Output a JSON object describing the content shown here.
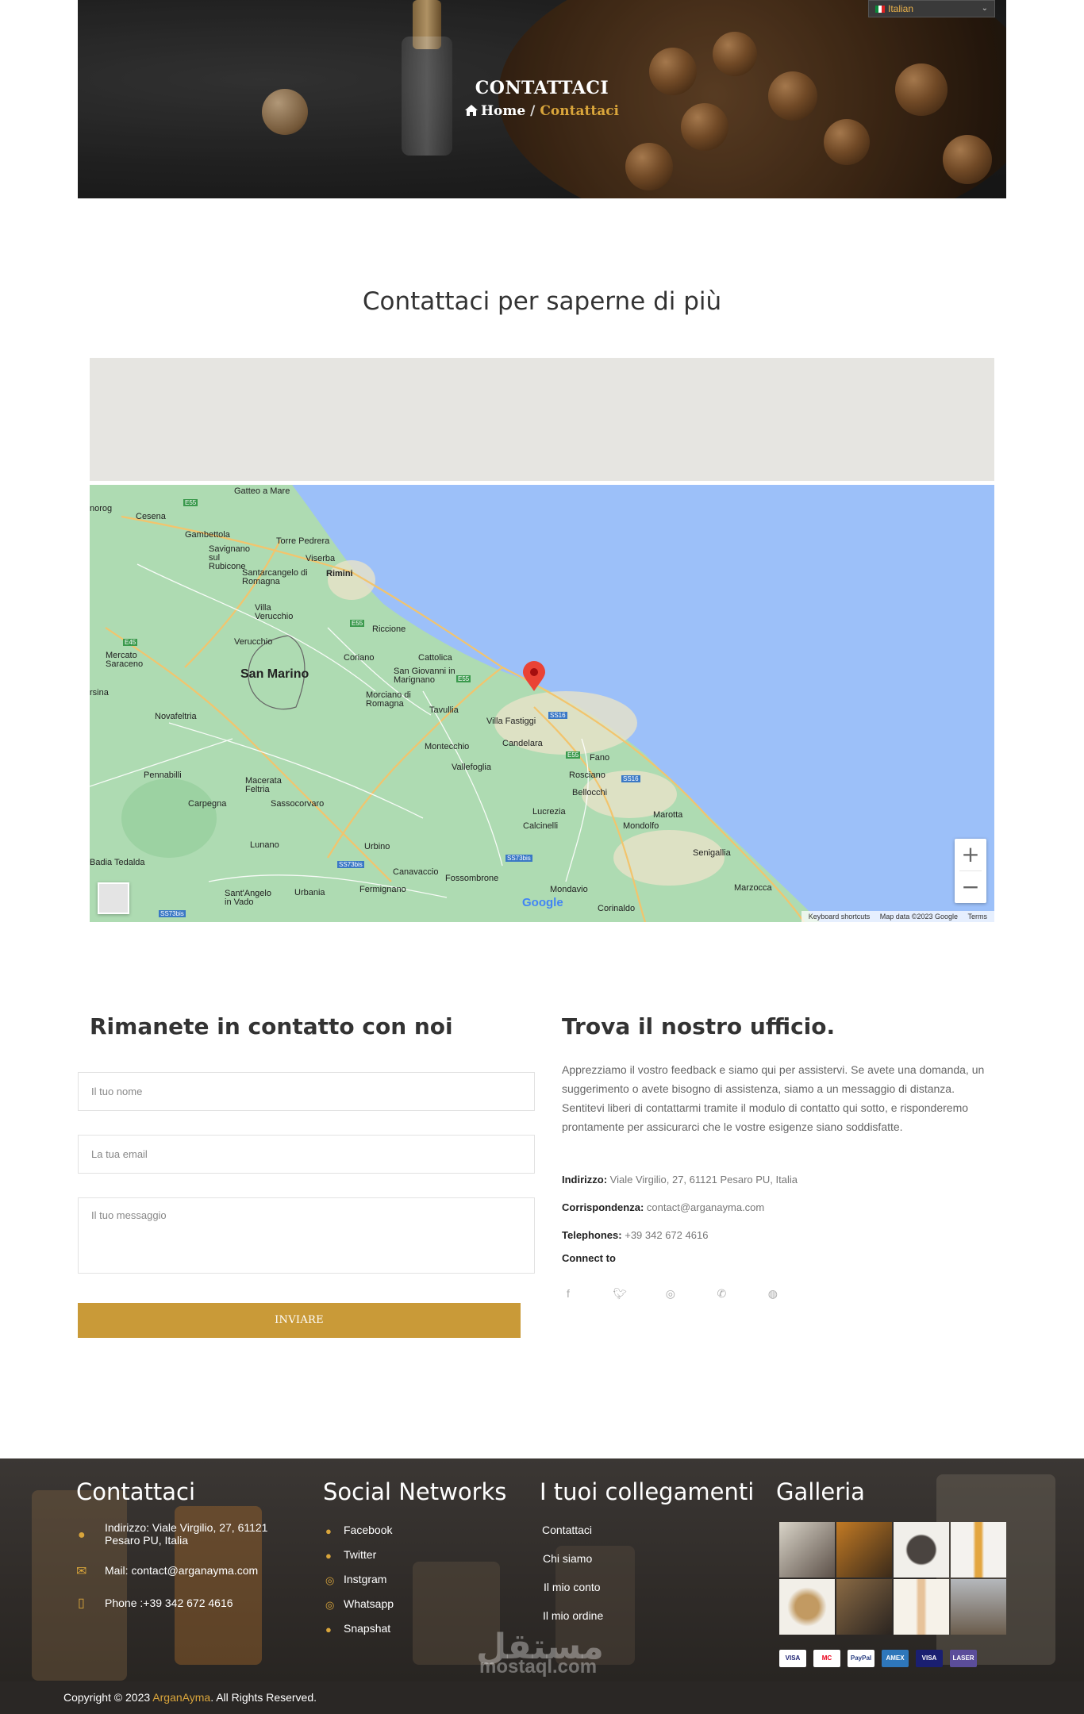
{
  "hero": {
    "title": "CONTATTACI",
    "breadcrumb_home": "Home",
    "breadcrumb_separator": "/",
    "breadcrumb_current": "Contattaci"
  },
  "language": {
    "selected": "Italian"
  },
  "section_heading": "Contattaci per saperne di più",
  "map": {
    "labels": {
      "gatteo": "Gatteo a Mare",
      "cesena": "Cesena",
      "gambettola": "Gambettola",
      "torre": "Torre Pedrera",
      "savignano": "Savignano sul Rubicone",
      "viserba": "Viserba",
      "santarcangelo": "Santarcangelo di Romagna",
      "rimini": "Rimini",
      "villa_verucchio": "Villa Verucchio",
      "verucchio": "Verucchio",
      "riccione": "Riccione",
      "mercato": "Mercato Saraceno",
      "coriano": "Coriano",
      "cattolica": "Cattolica",
      "san_marino": "San Marino",
      "san_giovanni": "San Giovanni in Marignano",
      "morciano": "Morciano di Romagna",
      "tavullia": "Tavullia",
      "villa_fastiggi": "Villa Fastiggi",
      "novafeltria": "Novafeltria",
      "candelara": "Candelara",
      "montecchio": "Montecchio",
      "fano": "Fano",
      "pennabilli": "Pennabilli",
      "vallefoglia": "Vallefoglia",
      "rosciano": "Rosciano",
      "macerata": "Macerata Feltria",
      "bellocchi": "Bellocchi",
      "carpegna": "Carpegna",
      "sassocorvaro": "Sassocorvaro",
      "lucrezia": "Lucrezia",
      "marotta": "Marotta",
      "calcinelli": "Calcinelli",
      "mondolfo": "Mondolfo",
      "lunano": "Lunano",
      "urbino": "Urbino",
      "senigallia": "Senigallia",
      "badia": "Badia Tedalda",
      "canavaccio": "Canavaccio",
      "fossombrone": "Fossombrone",
      "mondavio": "Mondavio",
      "marzocca": "Marzocca",
      "santangelo": "Sant'Angelo in Vado",
      "urbania": "Urbania",
      "fermignano": "Fermignano",
      "corinaldo": "Corinaldo",
      "sarsina": "rsina",
      "norogno": "norog"
    },
    "roads": {
      "e55a": "E55",
      "e45": "E45",
      "e55b": "E55",
      "e55c": "E55",
      "e55d": "E55",
      "ss16a": "SS16",
      "ss16b": "SS16",
      "ss73a": "SS73bis",
      "ss73b": "SS73bis",
      "ss73c": "SS73bis"
    },
    "zoom_in": "+",
    "zoom_out": "−",
    "google": "Google",
    "footer": {
      "shortcuts": "Keyboard shortcuts",
      "data": "Map data ©2023 Google",
      "terms": "Terms"
    }
  },
  "form": {
    "title": "Rimanete in contatto con noi",
    "name_placeholder": "Il tuo nome",
    "email_placeholder": "La tua email",
    "message_placeholder": "Il tuo messaggio",
    "submit_label": "INVIARE"
  },
  "office": {
    "title": "Trova il nostro ufficio.",
    "description": "Apprezziamo il vostro feedback e siamo qui per assistervi. Se avete una domanda, un suggerimento o avete bisogno di assistenza, siamo a un messaggio di distanza. Sentitevi liberi di contattarmi tramite il modulo di contatto qui sotto, e risponderemo prontamente per assicurarci che le vostre esigenze siano soddisfatte.",
    "address_label": "Indirizzo:",
    "address_value": "Viale Virgilio, 27, 61121 Pesaro PU, Italia",
    "mail_label": "Corrispondenza:",
    "mail_value": "contact@arganayma.com",
    "phone_label": "Telephones:",
    "phone_value": "+39 342 672 4616",
    "connect_label": "Connect to"
  },
  "footer": {
    "contact_title": "Contattaci",
    "contact_address": "Indirizzo: Viale Virgilio, 27, 61121",
    "contact_address2": "Pesaro PU, Italia",
    "contact_mail": "Mail: contact@arganayma.com",
    "contact_phone": "Phone :+39 342 672 4616",
    "social_title": "Social Networks",
    "social": [
      "Facebook",
      "Twitter",
      "Instgram",
      "Whatsapp",
      "Snapshat"
    ],
    "links_title": "I tuoi collegamenti",
    "links": [
      "Contattaci",
      "Chi siamo",
      "Il mio conto",
      "Il mio ordine"
    ],
    "gallery_title": "Galleria",
    "payments": [
      "VISA",
      "MC",
      "PayPal",
      "AMEX",
      "VISA",
      "LASER"
    ],
    "watermark": "مستقل",
    "watermark_sub": "mostaql.com"
  },
  "copyright": {
    "prefix": "Copyright © 2023 ",
    "brand": "ArganAyma",
    "suffix": ". All Rights Reserved."
  },
  "colors": {
    "accent": "#c99a38",
    "footer_bg": "#2f2b28",
    "sea": "#9cc0f9",
    "land": "#aedbb2"
  }
}
